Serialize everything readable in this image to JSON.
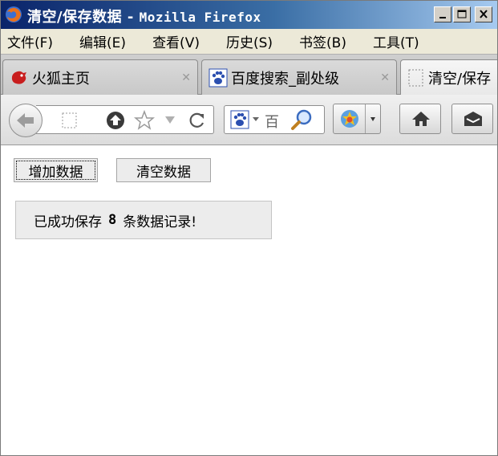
{
  "window": {
    "title_prefix": "清空/保存数据",
    "title_separator": " - ",
    "app_name": "Mozilla Firefox"
  },
  "menu": [
    {
      "label": "文件(F)"
    },
    {
      "label": "编辑(E)"
    },
    {
      "label": "查看(V)"
    },
    {
      "label": "历史(S)"
    },
    {
      "label": "书签(B)"
    },
    {
      "label": "工具(T)"
    }
  ],
  "tabs": [
    {
      "label": "火狐主页",
      "icon": "firefox-icon",
      "closable": true
    },
    {
      "label": "百度搜索_副处级",
      "icon": "baidu-paw-icon",
      "closable": true
    },
    {
      "label": "清空/保存",
      "icon": "blank-page-icon",
      "active": true
    }
  ],
  "navbar": {
    "search_engine_label": "百"
  },
  "page": {
    "add_button_label": "增加数据",
    "clear_button_label": "清空数据",
    "message_prefix": "已成功保存",
    "message_count": "8",
    "message_suffix": "条数据记录!"
  }
}
